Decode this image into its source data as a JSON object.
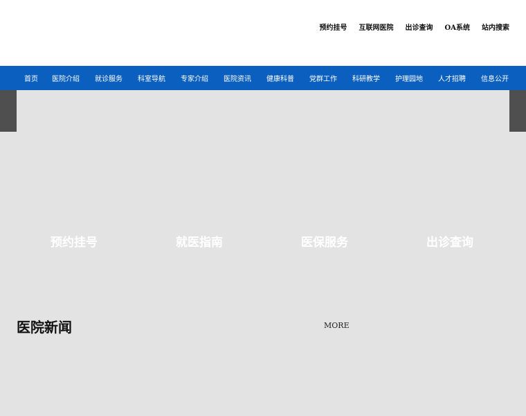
{
  "top_links": [
    "预约挂号",
    "互联网医院",
    "出诊查询",
    "OA系统",
    "站内搜索"
  ],
  "nav": [
    "首页",
    "医院介绍",
    "就诊服务",
    "科室导航",
    "专家介绍",
    "医院资讯",
    "健康科普",
    "党群工作",
    "科研教学",
    "护理园地",
    "人才招聘",
    "信息公开"
  ],
  "quick_links": [
    "预约挂号",
    "就医指南",
    "医保服务",
    "出诊查询"
  ],
  "news": {
    "title": "医院新闻",
    "more": "MORE"
  },
  "colors": {
    "nav_bg": "#0b5fbe",
    "page_bg": "#e3e3e3",
    "banner_edge": "#4f4f4f"
  }
}
